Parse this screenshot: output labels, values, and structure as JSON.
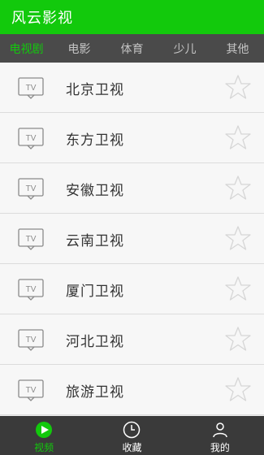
{
  "app": {
    "title": "风云影视"
  },
  "tabs": [
    {
      "label": "电视剧",
      "active": true
    },
    {
      "label": "电影",
      "active": false
    },
    {
      "label": "体育",
      "active": false
    },
    {
      "label": "少儿",
      "active": false
    },
    {
      "label": "其他",
      "active": false
    }
  ],
  "channels": [
    {
      "name": "北京卫视",
      "icon": "tv-icon",
      "favorite_icon": "star-outline-icon"
    },
    {
      "name": "东方卫视",
      "icon": "tv-icon",
      "favorite_icon": "star-outline-icon"
    },
    {
      "name": "安徽卫视",
      "icon": "tv-icon",
      "favorite_icon": "star-outline-icon"
    },
    {
      "name": "云南卫视",
      "icon": "tv-icon",
      "favorite_icon": "star-outline-icon"
    },
    {
      "name": "厦门卫视",
      "icon": "tv-icon",
      "favorite_icon": "star-outline-icon"
    },
    {
      "name": "河北卫视",
      "icon": "tv-icon",
      "favorite_icon": "star-outline-icon"
    },
    {
      "name": "旅游卫视",
      "icon": "tv-icon",
      "favorite_icon": "star-outline-icon"
    }
  ],
  "bottom_nav": [
    {
      "label": "视频",
      "icon": "play-icon",
      "active": true
    },
    {
      "label": "收藏",
      "icon": "clock-icon",
      "active": false
    },
    {
      "label": "我的",
      "icon": "user-icon",
      "active": false
    }
  ],
  "colors": {
    "accent": "#12c90c",
    "tab_bar": "#4a4a4a",
    "bottom_bar": "#3a3a3a"
  }
}
